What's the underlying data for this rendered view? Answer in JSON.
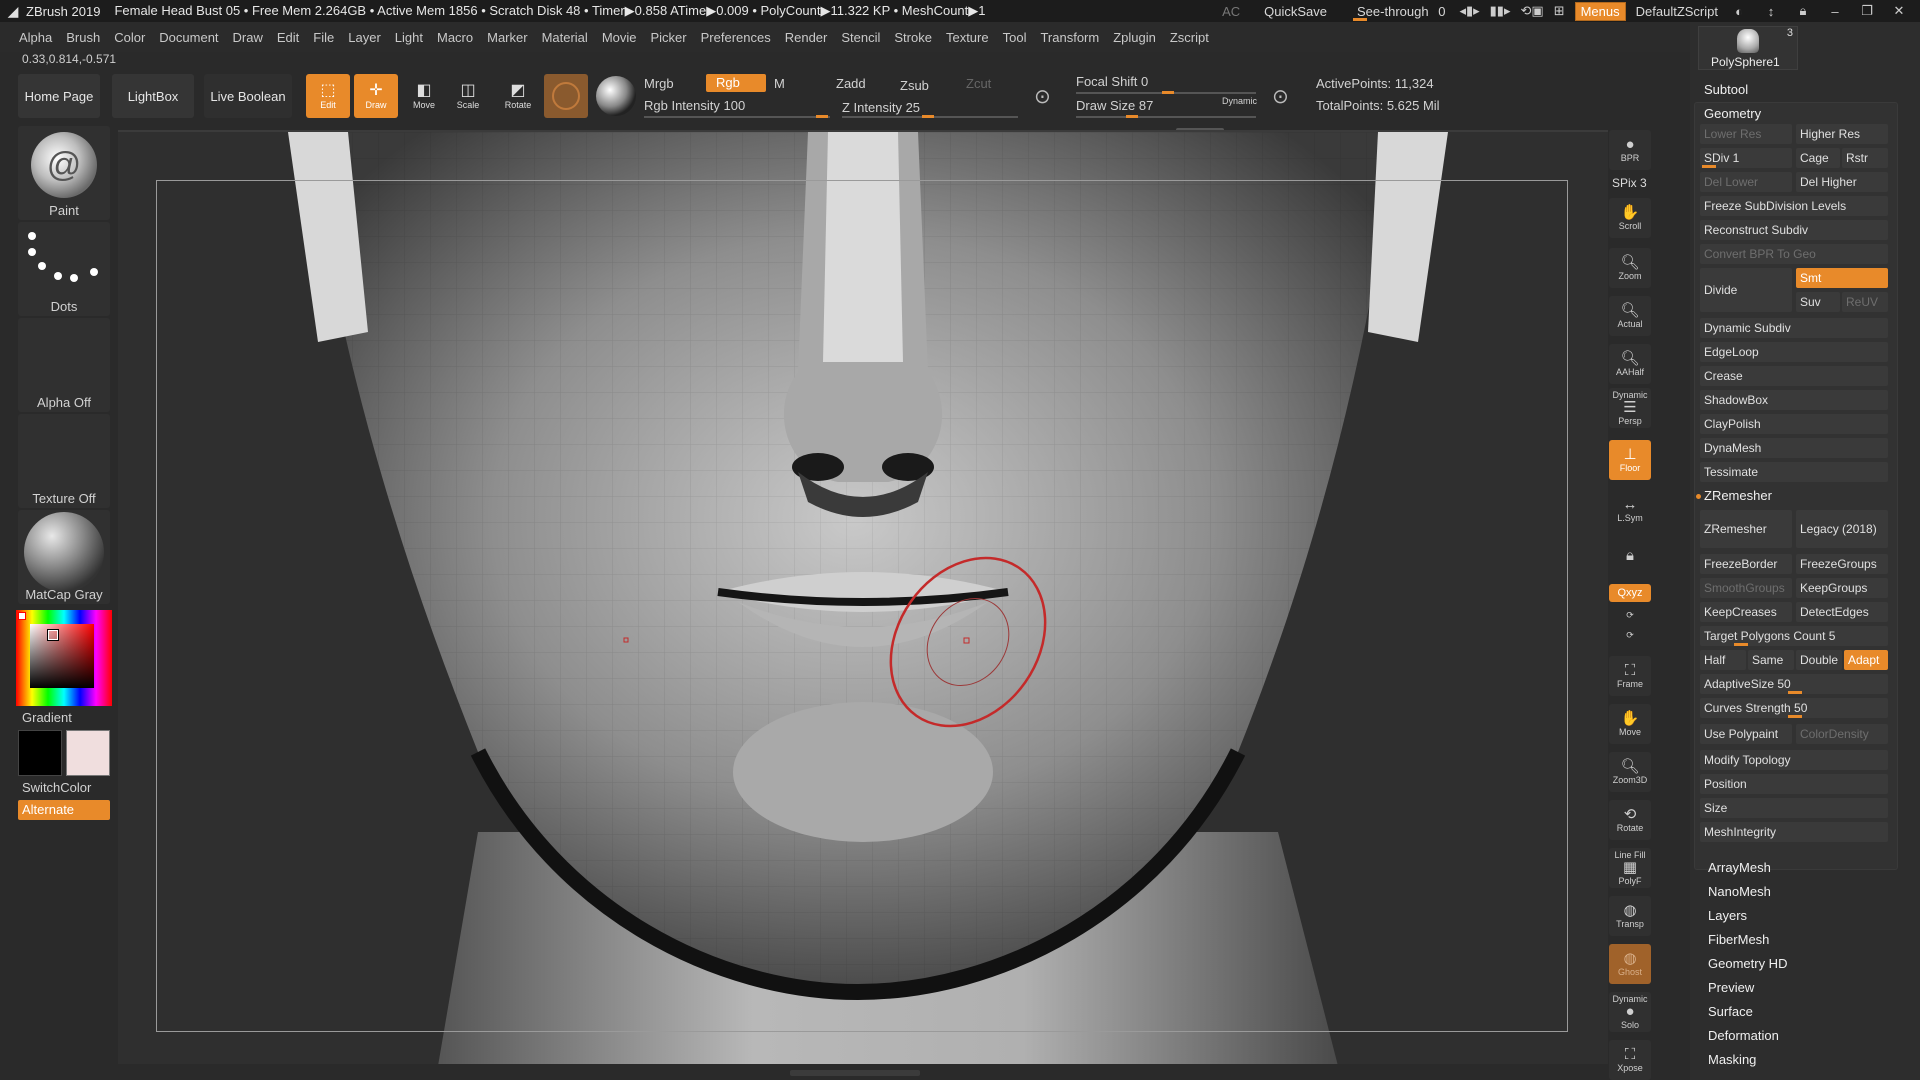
{
  "titlebar": {
    "app": "ZBrush 2019",
    "status": "Female Head Bust 05  • Free Mem 2.264GB • Active Mem 1856 • Scratch Disk 48 • Timer▶0.858 ATime▶0.009 • PolyCount▶11.322 KP  • MeshCount▶1",
    "ac": "AC",
    "quicksave": "QuickSave",
    "seethrough": "See-through",
    "seethrough_value": "0",
    "menus": "Menus",
    "script": "DefaultZScript"
  },
  "menubar": [
    "Alpha",
    "Brush",
    "Color",
    "Document",
    "Draw",
    "Edit",
    "File",
    "Layer",
    "Light",
    "Macro",
    "Marker",
    "Material",
    "Movie",
    "Picker",
    "Preferences",
    "Render",
    "Stencil",
    "Stroke",
    "Texture",
    "Tool",
    "Transform",
    "Zplugin",
    "Zscript"
  ],
  "coords": "0.33,0.814,-0.571",
  "toolbar": {
    "home": "Home Page",
    "lightbox": "LightBox",
    "liveboolean": "Live Boolean",
    "edit": "Edit",
    "draw": "Draw",
    "move": "Move",
    "scale": "Scale",
    "rotate": "Rotate",
    "mrgb": "Mrgb",
    "rgb": "Rgb",
    "m": "M",
    "rgb_intensity": "Rgb Intensity 100",
    "zadd": "Zadd",
    "zsub": "Zsub",
    "zcut": "Zcut",
    "z_intensity": "Z Intensity 25",
    "focal_shift": "Focal Shift 0",
    "draw_size": "Draw Size 87",
    "dynamic": "Dynamic",
    "active_points": "ActivePoints: 11,324",
    "total_points": "TotalPoints: 5.625 Mil"
  },
  "leftshelf": {
    "brush": "Paint",
    "stroke": "Dots",
    "alpha": "Alpha Off",
    "texture": "Texture Off",
    "material": "MatCap Gray",
    "gradient": "Gradient",
    "switchcolor": "SwitchColor",
    "alternate": "Alternate"
  },
  "rightstrip": {
    "bpr": "BPR",
    "spix": "SPix 3",
    "scroll": "Scroll",
    "zoom": "Zoom",
    "actual": "Actual",
    "aahalf": "AAHalf",
    "persp_top": "Dynamic",
    "persp": "Persp",
    "floor": "Floor",
    "lsym": "L.Sym",
    "xyz": "Qxyz",
    "frame": "Frame",
    "move": "Move",
    "zoom3d": "Zoom3D",
    "rotate": "Rotate",
    "linefill": "Line Fill",
    "polyf": "PolyF",
    "transp": "Transp",
    "ghost": "Ghost",
    "solo_top": "Dynamic",
    "solo": "Solo",
    "xpose": "Xpose"
  },
  "rpanel": {
    "subtool_name": "PolySphere1",
    "subtool_count": "3",
    "subtool": "Subtool",
    "geometry": "Geometry",
    "lower_res": "Lower Res",
    "higher_res": "Higher Res",
    "sdiv": "SDiv 1",
    "cage": "Cage",
    "rstr": "Rstr",
    "del_lower": "Del Lower",
    "del_higher": "Del Higher",
    "freeze_subdiv": "Freeze SubDivision Levels",
    "reconstruct": "Reconstruct Subdiv",
    "convert_bpr": "Convert BPR To Geo",
    "divide": "Divide",
    "smt": "Smt",
    "suv": "Suv",
    "reuv": "ReUV",
    "dynamic_subdiv": "Dynamic Subdiv",
    "edgeloop": "EdgeLoop",
    "crease": "Crease",
    "shadowbox": "ShadowBox",
    "claypolish": "ClayPolish",
    "dynamesh": "DynaMesh",
    "tessimate": "Tessimate",
    "zremesher_header": "ZRemesher",
    "zremesher_btn": "ZRemesher",
    "legacy": "Legacy (2018)",
    "freezeborder": "FreezeBorder",
    "freezegroups": "FreezeGroups",
    "smoothgroups": "SmoothGroups",
    "keepgroups": "KeepGroups",
    "keepcreases": "KeepCreases",
    "detectedges": "DetectEdges",
    "target_polys": "Target Polygons Count 5",
    "half": "Half",
    "same": "Same",
    "double": "Double",
    "adapt": "Adapt",
    "adaptivesize": "AdaptiveSize 50",
    "curves_strength": "Curves Strength 50",
    "use_polypaint": "Use Polypaint",
    "colordensity": "ColorDensity",
    "modify_topology": "Modify Topology",
    "position": "Position",
    "size": "Size",
    "meshintegrity": "MeshIntegrity",
    "arraymesh": "ArrayMesh",
    "nanomesh": "NanoMesh",
    "layers": "Layers",
    "fibermesh": "FiberMesh",
    "geometry_hd": "Geometry HD",
    "preview": "Preview",
    "surface": "Surface",
    "deformation": "Deformation",
    "masking": "Masking"
  },
  "colors": {
    "accent": "#e88a2a",
    "panel": "#2d2d2d",
    "brush_ring": "#c42a2a"
  }
}
